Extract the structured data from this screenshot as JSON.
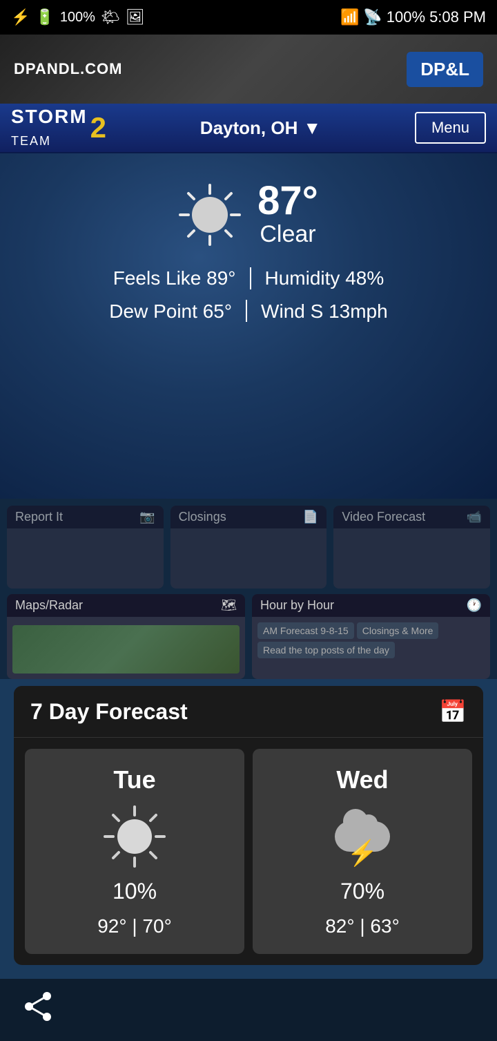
{
  "statusBar": {
    "icons": [
      "usb",
      "battery-100",
      "temp-87",
      "temp-71",
      "image",
      "wifi",
      "signal",
      "battery-full"
    ],
    "battery": "100%",
    "time": "5:08 PM"
  },
  "adBanner": {
    "website": "DPANDL.COM",
    "logoText": "DP&L"
  },
  "navBar": {
    "logoStorm": "STORM",
    "logoTeam": "TEAM",
    "logoNum": "2",
    "location": "Dayton, OH",
    "menuLabel": "Menu"
  },
  "currentWeather": {
    "temperature": "87°",
    "description": "Clear",
    "feelsLikeLabel": "Feels Like",
    "feelsLikeValue": "89°",
    "humidityLabel": "Humidity",
    "humidityValue": "48%",
    "dewPointLabel": "Dew Point",
    "dewPointValue": "65°",
    "windLabel": "Wind",
    "windValue": "S 13mph"
  },
  "appSwitcher": {
    "cards": [
      {
        "title": "Maps/Radar",
        "iconLabel": "map-icon"
      },
      {
        "title": "Hour by Hour",
        "iconLabel": "clock-icon",
        "subItems": [
          "AM Forecast 9-8-15",
          "Closings & More",
          "Read the top posts of the day"
        ]
      }
    ],
    "topCards": [
      {
        "title": "Report It",
        "iconLabel": "camera-icon"
      },
      {
        "title": "Closings",
        "iconLabel": "document-icon"
      },
      {
        "title": "Video Forecast",
        "iconLabel": "video-icon"
      }
    ]
  },
  "forecastCard": {
    "title": "7 Day Forecast",
    "iconLabel": "calendar-icon",
    "days": [
      {
        "name": "Tue",
        "weatherType": "sunny",
        "precipPct": "10%",
        "highTemp": "92°",
        "lowTemp": "70°"
      },
      {
        "name": "Wed",
        "weatherType": "thunderstorm",
        "precipPct": "70%",
        "highTemp": "82°",
        "lowTemp": "63°"
      }
    ]
  },
  "bottomBar": {
    "shareIconLabel": "share-icon"
  }
}
